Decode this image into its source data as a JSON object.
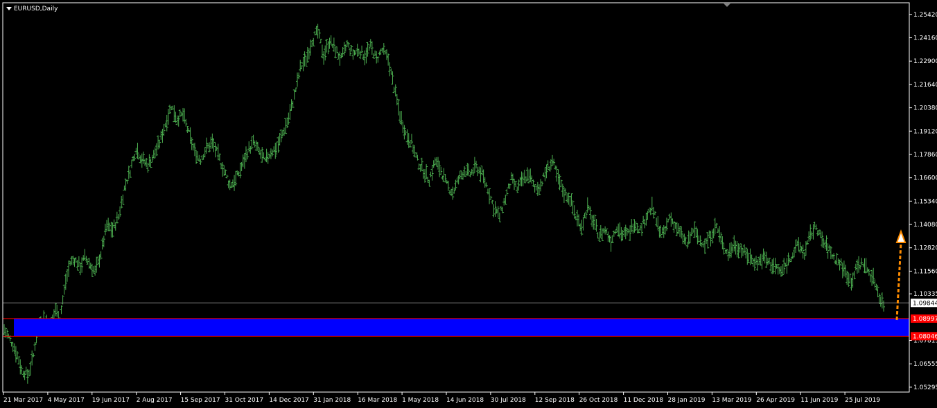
{
  "chart_data": {
    "type": "bar",
    "title": "EURUSD,Daily",
    "ylim": [
      1.0503,
      1.2605
    ],
    "y_ticks": [
      "1.25420",
      "1.24160",
      "1.22900",
      "1.21640",
      "1.20380",
      "1.19120",
      "1.17860",
      "1.16600",
      "1.15340",
      "1.14080",
      "1.12820",
      "1.11560",
      "1.10335",
      "1.07815",
      "1.06555",
      "1.05295"
    ],
    "x_ticks": [
      "21 Mar 2017",
      "4 May 2017",
      "19 Jun 2017",
      "2 Aug 2017",
      "15 Sep 2017",
      "31 Oct 2017",
      "14 Dec 2017",
      "31 Jan 2018",
      "16 Mar 2018",
      "1 May 2018",
      "14 Jun 2018",
      "30 Jul 2018",
      "12 Sep 2018",
      "26 Oct 2018",
      "11 Dec 2018",
      "28 Jan 2019",
      "13 Mar 2019",
      "26 Apr 2019",
      "11 Jun 2019",
      "25 Jul 2019"
    ],
    "series": [
      {
        "values": [
          [
            0,
            1.084
          ],
          [
            3,
            1.08
          ],
          [
            6,
            1.076
          ],
          [
            8,
            1.072
          ],
          [
            10,
            1.068
          ],
          [
            12,
            1.062
          ],
          [
            14,
            1.061
          ],
          [
            16,
            1.059
          ],
          [
            18,
            1.064
          ],
          [
            20,
            1.07
          ],
          [
            22,
            1.082
          ],
          [
            25,
            1.089
          ],
          [
            28,
            1.09
          ],
          [
            30,
            1.086
          ],
          [
            32,
            1.088
          ],
          [
            35,
            1.095
          ],
          [
            38,
            1.09
          ],
          [
            40,
            1.1
          ],
          [
            42,
            1.11
          ],
          [
            45,
            1.12
          ],
          [
            48,
            1.122
          ],
          [
            52,
            1.118
          ],
          [
            55,
            1.123
          ],
          [
            58,
            1.12
          ],
          [
            62,
            1.115
          ],
          [
            66,
            1.125
          ],
          [
            70,
            1.14
          ],
          [
            74,
            1.138
          ],
          [
            78,
            1.145
          ],
          [
            82,
            1.16
          ],
          [
            86,
            1.17
          ],
          [
            90,
            1.182
          ],
          [
            94,
            1.176
          ],
          [
            98,
            1.173
          ],
          [
            102,
            1.178
          ],
          [
            106,
            1.185
          ],
          [
            110,
            1.195
          ],
          [
            114,
            1.205
          ],
          [
            118,
            1.198
          ],
          [
            122,
            1.2
          ],
          [
            126,
            1.19
          ],
          [
            130,
            1.18
          ],
          [
            134,
            1.176
          ],
          [
            138,
            1.182
          ],
          [
            142,
            1.185
          ],
          [
            146,
            1.178
          ],
          [
            150,
            1.17
          ],
          [
            154,
            1.162
          ],
          [
            158,
            1.165
          ],
          [
            162,
            1.172
          ],
          [
            166,
            1.18
          ],
          [
            170,
            1.185
          ],
          [
            174,
            1.18
          ],
          [
            178,
            1.175
          ],
          [
            182,
            1.18
          ],
          [
            186,
            1.182
          ],
          [
            190,
            1.19
          ],
          [
            194,
            1.198
          ],
          [
            198,
            1.21
          ],
          [
            202,
            1.225
          ],
          [
            206,
            1.23
          ],
          [
            210,
            1.24
          ],
          [
            214,
            1.245
          ],
          [
            218,
            1.232
          ],
          [
            222,
            1.24
          ],
          [
            226,
            1.235
          ],
          [
            230,
            1.23
          ],
          [
            234,
            1.238
          ],
          [
            238,
            1.233
          ],
          [
            242,
            1.235
          ],
          [
            246,
            1.232
          ],
          [
            250,
            1.237
          ],
          [
            254,
            1.23
          ],
          [
            258,
            1.235
          ],
          [
            262,
            1.23
          ],
          [
            266,
            1.215
          ],
          [
            270,
            1.2
          ],
          [
            274,
            1.19
          ],
          [
            278,
            1.185
          ],
          [
            282,
            1.175
          ],
          [
            286,
            1.17
          ],
          [
            290,
            1.165
          ],
          [
            294,
            1.175
          ],
          [
            298,
            1.17
          ],
          [
            302,
            1.162
          ],
          [
            306,
            1.158
          ],
          [
            310,
            1.165
          ],
          [
            314,
            1.17
          ],
          [
            318,
            1.168
          ],
          [
            322,
            1.172
          ],
          [
            326,
            1.168
          ],
          [
            330,
            1.16
          ],
          [
            334,
            1.15
          ],
          [
            338,
            1.145
          ],
          [
            342,
            1.155
          ],
          [
            346,
            1.165
          ],
          [
            350,
            1.16
          ],
          [
            354,
            1.165
          ],
          [
            358,
            1.168
          ],
          [
            362,
            1.16
          ],
          [
            366,
            1.162
          ],
          [
            370,
            1.17
          ],
          [
            374,
            1.175
          ],
          [
            378,
            1.165
          ],
          [
            382,
            1.158
          ],
          [
            386,
            1.155
          ],
          [
            390,
            1.145
          ],
          [
            394,
            1.14
          ],
          [
            398,
            1.15
          ],
          [
            402,
            1.142
          ],
          [
            406,
            1.135
          ],
          [
            410,
            1.138
          ],
          [
            414,
            1.132
          ],
          [
            418,
            1.14
          ],
          [
            422,
            1.135
          ],
          [
            426,
            1.136
          ],
          [
            430,
            1.142
          ],
          [
            434,
            1.138
          ],
          [
            438,
            1.145
          ],
          [
            442,
            1.15
          ],
          [
            446,
            1.14
          ],
          [
            450,
            1.135
          ],
          [
            454,
            1.145
          ],
          [
            458,
            1.14
          ],
          [
            462,
            1.135
          ],
          [
            466,
            1.13
          ],
          [
            470,
            1.138
          ],
          [
            474,
            1.133
          ],
          [
            478,
            1.13
          ],
          [
            482,
            1.135
          ],
          [
            486,
            1.14
          ],
          [
            490,
            1.13
          ],
          [
            494,
            1.125
          ],
          [
            498,
            1.13
          ],
          [
            502,
            1.128
          ],
          [
            506,
            1.125
          ],
          [
            510,
            1.122
          ],
          [
            514,
            1.12
          ],
          [
            518,
            1.123
          ],
          [
            522,
            1.12
          ],
          [
            526,
            1.118
          ],
          [
            530,
            1.115
          ],
          [
            534,
            1.12
          ],
          [
            538,
            1.125
          ],
          [
            542,
            1.13
          ],
          [
            546,
            1.125
          ],
          [
            550,
            1.135
          ],
          [
            554,
            1.14
          ],
          [
            558,
            1.132
          ],
          [
            562,
            1.128
          ],
          [
            566,
            1.123
          ],
          [
            570,
            1.12
          ],
          [
            574,
            1.115
          ],
          [
            578,
            1.11
          ],
          [
            582,
            1.118
          ],
          [
            586,
            1.12
          ],
          [
            590,
            1.115
          ],
          [
            594,
            1.11
          ],
          [
            598,
            1.1
          ],
          [
            600,
            1.098
          ]
        ],
        "last_index": 600
      }
    ],
    "current_price": "1.09844",
    "zone_upper": "1.08997",
    "zone_lower": "1.08046",
    "colors": {
      "background": "#000000",
      "bars": "#4caf50",
      "zone": "#0000ff",
      "zone_border": "#ff0000",
      "zone_label_bg": "#ff0000",
      "current_price_line": "#808080",
      "arrow": "#ff8c00",
      "axis": "#ffffff"
    },
    "grid": false,
    "legend": "none"
  }
}
